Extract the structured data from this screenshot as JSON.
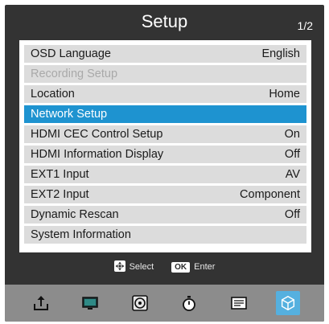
{
  "header": {
    "title": "Setup",
    "page": "1/2"
  },
  "menu": {
    "items": [
      {
        "label": "OSD Language",
        "value": "English",
        "state": "normal"
      },
      {
        "label": "Recording Setup",
        "value": "",
        "state": "disabled"
      },
      {
        "label": "Location",
        "value": "Home",
        "state": "normal"
      },
      {
        "label": "Network Setup",
        "value": "",
        "state": "selected"
      },
      {
        "label": "HDMI CEC Control Setup",
        "value": "On",
        "state": "normal"
      },
      {
        "label": "HDMI Information Display",
        "value": "Off",
        "state": "normal"
      },
      {
        "label": "EXT1 Input",
        "value": "AV",
        "state": "normal"
      },
      {
        "label": "EXT2 Input",
        "value": "Component",
        "state": "normal"
      },
      {
        "label": "Dynamic Rescan",
        "value": "Off",
        "state": "normal"
      },
      {
        "label": "System Information",
        "value": "",
        "state": "normal"
      }
    ]
  },
  "hints": {
    "select_label": "Select",
    "ok_key": "OK",
    "enter_label": "Enter"
  },
  "bottom_bar": {
    "icons": [
      "upload-icon",
      "tv-screen-icon",
      "media-disc-icon",
      "timer-icon",
      "guide-list-icon",
      "setup-cube-icon"
    ],
    "active": "setup-cube-icon"
  },
  "colors": {
    "background": "#333333",
    "row": "#dcdcdc",
    "selected_row": "#1e93d0",
    "disabled_text": "#a9a9a9",
    "bottom_bar": "#8c8c8c",
    "active_icon": "#55b0df"
  }
}
